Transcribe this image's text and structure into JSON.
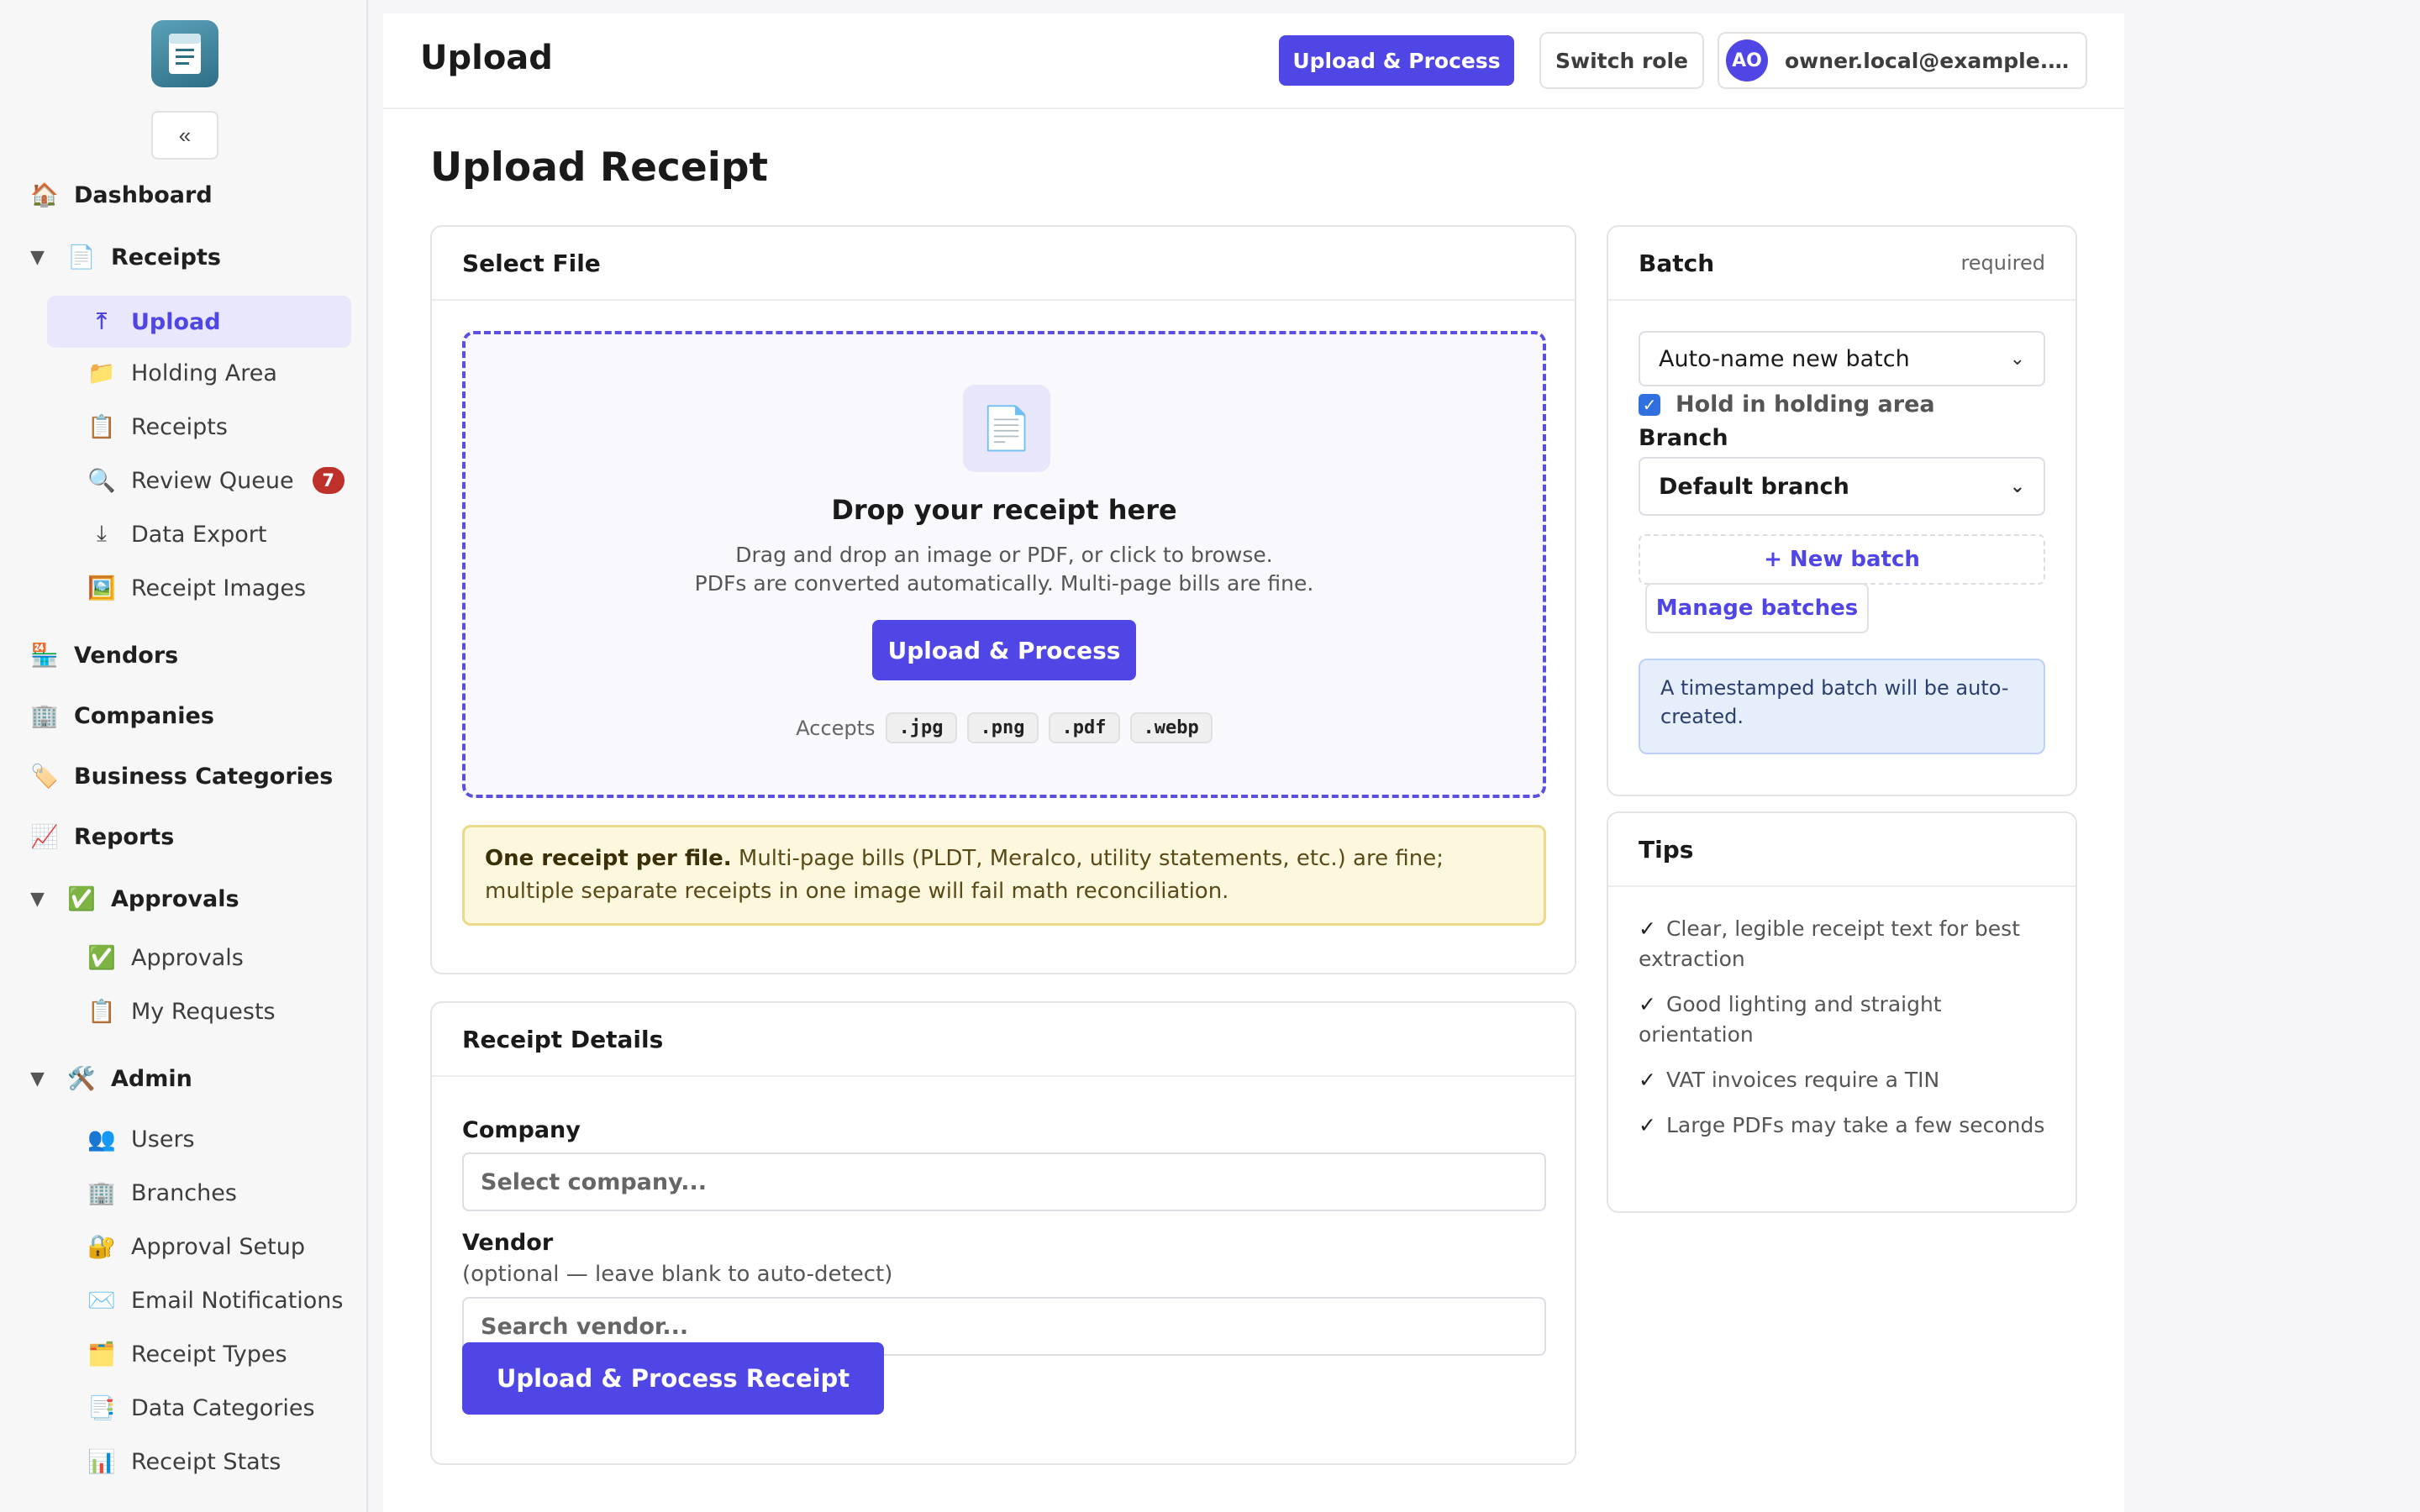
{
  "sidebar": {
    "collapse_label": "«",
    "top_items": [
      {
        "label": "Dashboard",
        "icon": "🏠"
      }
    ],
    "receipts": {
      "caret": "▼",
      "icon": "📄",
      "label": "Receipts",
      "items": [
        {
          "label": "Upload",
          "icon": "⤒"
        },
        {
          "label": "Holding Area",
          "icon": "📁"
        },
        {
          "label": "Receipts",
          "icon": "📋"
        },
        {
          "label": "Review Queue",
          "icon": "🔍",
          "badge": "7"
        },
        {
          "label": "Data Export",
          "icon": "⤓"
        },
        {
          "label": "Receipt Images",
          "icon": "🖼️"
        }
      ]
    },
    "mid_items": [
      {
        "label": "Vendors",
        "icon": "🏪"
      },
      {
        "label": "Companies",
        "icon": "🏢"
      },
      {
        "label": "Business Categories",
        "icon": "🏷️"
      },
      {
        "label": "Reports",
        "icon": "📈"
      }
    ],
    "approvals": {
      "caret": "▼",
      "icon": "✅",
      "label": "Approvals",
      "items": [
        {
          "label": "Approvals",
          "icon": "✅"
        },
        {
          "label": "My Requests",
          "icon": "📋"
        }
      ]
    },
    "admin": {
      "caret": "▼",
      "icon": "🛠️",
      "label": "Admin",
      "items": [
        {
          "label": "Users",
          "icon": "👥"
        },
        {
          "label": "Branches",
          "icon": "🏢"
        },
        {
          "label": "Approval Setup",
          "icon": "🔐"
        },
        {
          "label": "Email Notifications",
          "icon": "✉️"
        },
        {
          "label": "Receipt Types",
          "icon": "🗂️"
        },
        {
          "label": "Data Categories",
          "icon": "📑"
        },
        {
          "label": "Receipt Stats",
          "icon": "📊"
        }
      ]
    }
  },
  "header": {
    "title": "Upload",
    "upload_button": "Upload & Process",
    "switch_role_button": "Switch role",
    "user": {
      "initials": "AO",
      "email": "owner.local@example.t..."
    }
  },
  "page": {
    "title": "Upload Receipt"
  },
  "select_file": {
    "title": "Select File",
    "drop_title": "Drop your receipt here",
    "drop_line1": "Drag and drop an image or PDF, or click to browse.",
    "drop_line2": "PDFs are converted automatically. Multi-page bills are fine.",
    "button": "Upload & Process",
    "accepts_label": "Accepts",
    "formats": [
      ".jpg",
      ".png",
      ".pdf",
      ".webp"
    ],
    "warning_bold": "One receipt per file.",
    "warning_text": " Multi-page bills (PLDT, Meralco, utility statements, etc.) are fine; multiple separate receipts in one image will fail math reconciliation."
  },
  "receipt_details": {
    "title": "Receipt Details",
    "company_label": "Company",
    "company_placeholder": "Select company...",
    "vendor_label": "Vendor",
    "vendor_hint": "(optional — leave blank to auto-detect)",
    "vendor_placeholder": "Search vendor...",
    "submit_button": "Upload & Process Receipt"
  },
  "batch": {
    "title": "Batch",
    "required_label": "required",
    "batch_select_value": "Auto-name new batch",
    "hold_label": "Hold in holding area",
    "hold_checked": true,
    "branch_label": "Branch",
    "branch_select_value": "Default branch",
    "new_batch_button": "+ New batch",
    "manage_button": "Manage batches",
    "info": "A timestamped batch will be auto-created."
  },
  "tips": {
    "title": "Tips",
    "items": [
      "Clear, legible receipt text for best extraction",
      "Good lighting and straight orientation",
      "VAT invoices require a TIN",
      "Large PDFs may take a few seconds"
    ]
  },
  "colors": {
    "accent": "#5046e5",
    "badge": "#c0302a",
    "warning_bg": "#fdf7dd",
    "info_bg": "#e6eefc"
  }
}
